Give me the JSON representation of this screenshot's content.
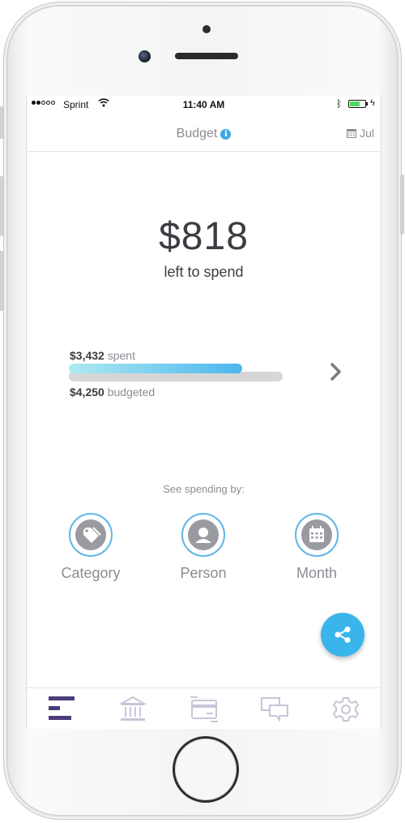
{
  "status_bar": {
    "carrier": "Sprint",
    "time": "11:40 AM"
  },
  "header": {
    "title": "Budget",
    "info_icon": "info-icon",
    "month_label": "Jul",
    "month_icon": "calendar-icon"
  },
  "summary": {
    "remaining": "$818",
    "remaining_caption": "left to spend",
    "spent_amount": "$3,432",
    "spent_word": "spent",
    "budgeted_amount": "$4,250",
    "budgeted_word": "budgeted",
    "spent_fraction": 0.81
  },
  "spending_by": {
    "heading": "See spending by:",
    "options": [
      {
        "label": "Category",
        "icon": "tag-icon"
      },
      {
        "label": "Person",
        "icon": "person-icon"
      },
      {
        "label": "Month",
        "icon": "calendar-icon"
      }
    ]
  },
  "fab": {
    "icon": "share-icon"
  },
  "tab_bar": {
    "tabs": [
      {
        "icon": "budget-bars-icon",
        "active": true
      },
      {
        "icon": "bank-icon",
        "active": false
      },
      {
        "icon": "transactions-card-icon",
        "active": false
      },
      {
        "icon": "chat-icon",
        "active": false
      },
      {
        "icon": "gear-icon",
        "active": false
      }
    ]
  },
  "colors": {
    "accent_blue": "#3ab5ec",
    "bar_gradient_start": "#aeeaf0",
    "bar_gradient_end": "#4cb6ee",
    "tab_active": "#4b3b7a",
    "tab_inactive": "#c9c5d8",
    "text_dark": "#3c3c42",
    "text_muted": "#8c8c93"
  }
}
